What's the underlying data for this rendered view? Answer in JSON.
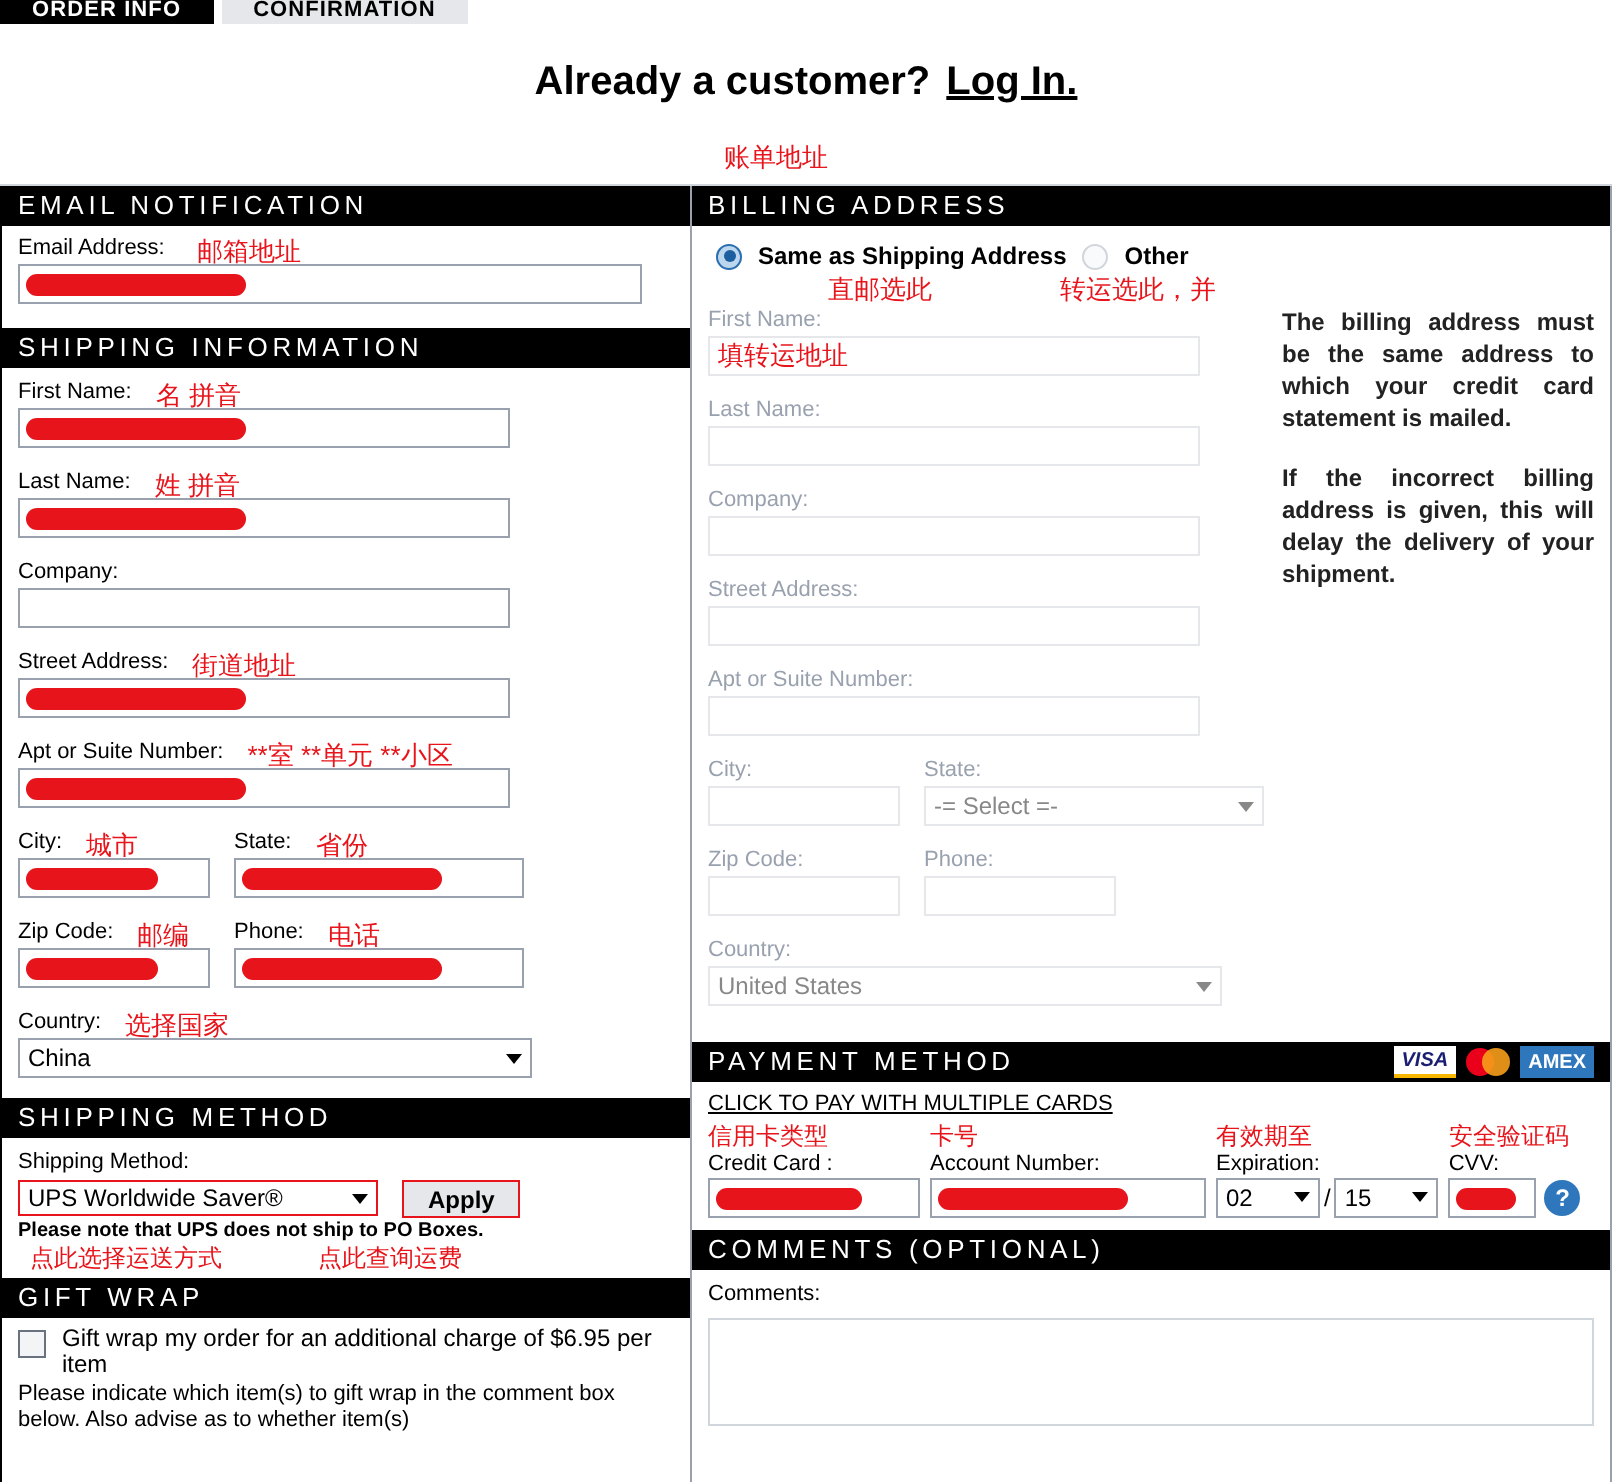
{
  "tabs": [
    {
      "label": "ORDER INFO",
      "selected": true
    },
    {
      "label": "CONFIRMATION",
      "selected": false
    }
  ],
  "login_prompt": {
    "text": "Already a customer?",
    "link": "Log In."
  },
  "billing_annotation": "账单地址",
  "email": {
    "title": "EMAIL  NOTIFICATION",
    "field": {
      "label": "Email Address:",
      "annotation": "邮箱地址",
      "redacted": true
    }
  },
  "shipping_info": {
    "title": "SHIPPING INFORMATION",
    "rows": [
      [
        {
          "kind": "input",
          "label": "First Name:",
          "annotation": "名 拼音",
          "redacted": true
        }
      ],
      [
        {
          "kind": "input",
          "label": "Last Name:",
          "annotation": "姓 拼音",
          "redacted": true
        }
      ],
      [
        {
          "kind": "input",
          "label": "Company:"
        }
      ],
      [
        {
          "kind": "input",
          "label": "Street Address:",
          "annotation": "街道地址",
          "redacted": true
        }
      ],
      [
        {
          "kind": "input",
          "label": "Apt or Suite Number:",
          "annotation": "**室 **单元 **小区",
          "redacted": true
        }
      ],
      [
        {
          "kind": "input",
          "label": "City:",
          "annotation": "城市",
          "redacted": true
        },
        {
          "kind": "input",
          "label": "State:",
          "annotation": "省份",
          "redacted": true
        }
      ],
      [
        {
          "kind": "input",
          "label": "Zip Code:",
          "annotation": "邮编",
          "redacted": true
        },
        {
          "kind": "input",
          "label": "Phone:",
          "annotation": "电话",
          "redacted": true
        }
      ],
      [
        {
          "kind": "select",
          "label": "Country:",
          "annotation": "选择国家",
          "value": "China"
        }
      ]
    ]
  },
  "shipping_method": {
    "title": "SHIPPING METHOD",
    "label": "Shipping Method:",
    "value": "UPS Worldwide Saver®",
    "button": "Apply",
    "note": "Please note that UPS does not ship to PO Boxes.",
    "annotations": [
      "点此选择运送方式",
      "点此查询运费"
    ]
  },
  "gift_wrap": {
    "title": "GIFT WRAP",
    "checked": false,
    "label": "Gift wrap my order for an additional charge of $6.95 per item",
    "text": "Please indicate which item(s) to gift wrap in the comment box below. Also advise as to whether item(s)"
  },
  "billing": {
    "title": "BILLING ADDRESS",
    "options": [
      {
        "label": "Same as Shipping Address",
        "selected": true
      },
      {
        "label": "Other",
        "selected": false
      }
    ],
    "annotations": [
      "直邮选此",
      "转运选此，并"
    ],
    "rows": [
      [
        {
          "kind": "input",
          "label": "First Name:",
          "inner_annotation": "填转运地址",
          "disabled": true
        }
      ],
      [
        {
          "kind": "input",
          "label": "Last Name:",
          "disabled": true
        }
      ],
      [
        {
          "kind": "input",
          "label": "Company:",
          "disabled": true
        }
      ],
      [
        {
          "kind": "input",
          "label": "Street Address:",
          "disabled": true
        }
      ],
      [
        {
          "kind": "input",
          "label": "Apt or Suite Number:",
          "disabled": true
        }
      ],
      [
        {
          "kind": "input",
          "label": "City:",
          "disabled": true
        },
        {
          "kind": "select",
          "label": "State:",
          "value": "-= Select =-",
          "disabled": true
        }
      ],
      [
        {
          "kind": "input",
          "label": "Zip Code:",
          "disabled": true
        },
        {
          "kind": "input",
          "label": "Phone:",
          "disabled": true
        }
      ],
      [
        {
          "kind": "select",
          "label": "Country:",
          "value": "United States",
          "disabled": true
        }
      ]
    ],
    "note": [
      "The billing address must be the same address to which your credit card statement is mailed.",
      "If the incorrect billing address is given, this will delay the delivery of your shipment."
    ]
  },
  "payment": {
    "title": "PAYMENT METHOD",
    "card_logos": [
      {
        "kind": "visa",
        "label": "VISA"
      },
      {
        "kind": "mastercard"
      },
      {
        "kind": "amex",
        "label": "AMEX"
      }
    ],
    "link": "CLICK TO PAY WITH MULTIPLE CARDS",
    "fields": [
      {
        "kind": "select",
        "annotation": "信用卡类型",
        "label": "Credit Card :",
        "redacted": true
      },
      {
        "kind": "input",
        "annotation": "卡号",
        "label": "Account Number:",
        "redacted": true
      },
      {
        "kind": "expiry",
        "annotation": "有效期至",
        "label": "Expiration:",
        "month": "02",
        "separator": "/",
        "year": "15"
      },
      {
        "kind": "cvv",
        "annotation": "安全验证码",
        "label": "CVV:",
        "help": "?",
        "redacted": true
      }
    ]
  },
  "comments": {
    "title": "COMMENTS (OPTIONAL)",
    "label": "Comments:"
  }
}
